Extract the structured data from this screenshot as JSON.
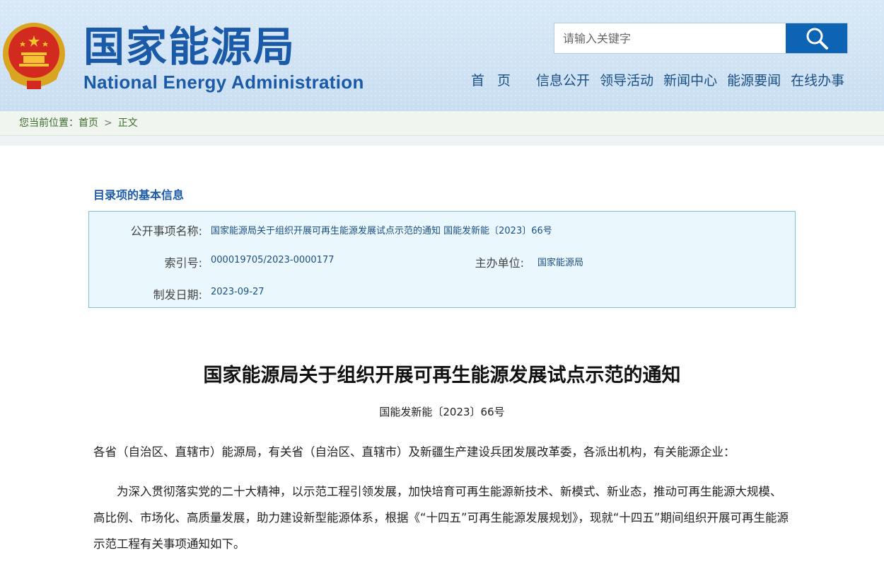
{
  "header": {
    "logo_cn": "国家能源局",
    "logo_en": "National Energy Administration",
    "search": {
      "placeholder": "请输入关键字"
    },
    "nav": [
      "首 页",
      "信息公开",
      "领导活动",
      "新闻中心",
      "能源要闻",
      "在线办事"
    ],
    "colors": {
      "brand": "#1a5aa8",
      "search_button": "#0d63b4"
    }
  },
  "breadcrumb": {
    "prefix": "您当前位置：",
    "home": "首页",
    "separator": ">",
    "current": "正文"
  },
  "info": {
    "section_title": "目录项的基本信息",
    "name_label": "公开事项名称:",
    "name_value": "国家能源局关于组织开展可再生能源发展试点示范的通知 国能发新能〔2023〕66号",
    "index_label": "索引号:",
    "index_value": "000019705/2023-0000177",
    "org_label": "主办单位:",
    "org_value": "国家能源局",
    "date_label": "制发日期:",
    "date_value": "2023-09-27"
  },
  "document": {
    "title": "国家能源局关于组织开展可再生能源发展试点示范的通知",
    "number": "国能发新能〔2023〕66号",
    "salutation": "各省（自治区、直辖市）能源局，有关省（自治区、直辖市）及新疆生产建设兵团发展改革委，各派出机构，有关能源企业：",
    "body": "为深入贯彻落实党的二十大精神，以示范工程引领发展，加快培育可再生能源新技术、新模式、新业态，推动可再生能源大规模、高比例、市场化、高质量发展，助力建设新型能源体系，根据《“十四五”可再生能源发展规划》，现就“十四五”期间组织开展可再生能源示范工程有关事项通知如下。"
  }
}
